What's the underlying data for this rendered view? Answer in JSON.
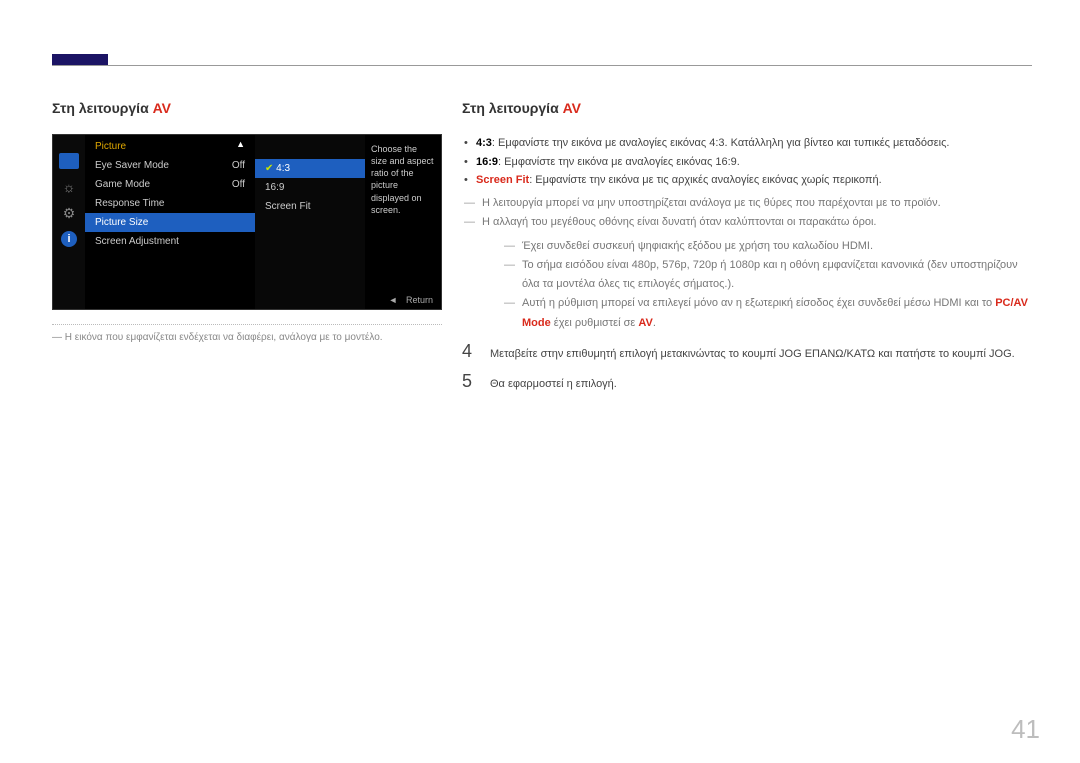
{
  "page_number": "41",
  "left": {
    "heading_prefix": "Στη λειτουργία ",
    "heading_av": "AV",
    "osd": {
      "title": "Picture",
      "items": [
        {
          "label": "Eye Saver Mode",
          "value": "Off"
        },
        {
          "label": "Game Mode",
          "value": "Off"
        },
        {
          "label": "Response Time",
          "value": ""
        },
        {
          "label": "Picture Size",
          "value": ""
        },
        {
          "label": "Screen Adjustment",
          "value": ""
        }
      ],
      "sub_options": [
        "4:3",
        "16:9",
        "Screen Fit"
      ],
      "description": "Choose the size and aspect ratio of the picture displayed on screen.",
      "return_label": "Return",
      "info_glyph": "i"
    },
    "caption_dash": "―",
    "caption": "Η εικόνα που εμφανίζεται ενδέχεται να διαφέρει, ανάλογα με το μοντέλο."
  },
  "right": {
    "heading_prefix": "Στη λειτουργία ",
    "heading_av": "AV",
    "bullet1_label": "4:3",
    "bullet1_text": ": Εμφανίστε την εικόνα με αναλογίες εικόνας 4:3. Κατάλληλη για βίντεο και τυπικές μεταδόσεις.",
    "bullet2_label": "16:9",
    "bullet2_text": ": Εμφανίστε την εικόνα με αναλογίες εικόνας 16:9.",
    "bullet3_label": "Screen Fit",
    "bullet3_text": ": Εμφανίστε την εικόνα με τις αρχικές αναλογίες εικόνας χωρίς περικοπή.",
    "dash1": "Η λειτουργία μπορεί να μην υποστηρίζεται ανάλογα με τις θύρες που παρέχονται με το προϊόν.",
    "dash2": "Η αλλαγή του μεγέθους οθόνης είναι δυνατή όταν καλύπτονται οι παρακάτω όροι.",
    "sub1": "Έχει συνδεθεί συσκευή ψηφιακής εξόδου με χρήση του καλωδίου HDMI.",
    "sub2": "Το σήμα εισόδου είναι 480p, 576p, 720p ή 1080p και η οθόνη εμφανίζεται κανονικά (δεν υποστηρίζουν όλα τα μοντέλα όλες τις επιλογές σήματος.).",
    "sub3_a": "Αυτή η ρύθμιση μπορεί να επιλεγεί μόνο αν η εξωτερική είσοδος έχει συνδεθεί μέσω HDMI και το ",
    "sub3_pcav": "PC/AV Mode",
    "sub3_b": " έχει ρυθμιστεί σε ",
    "sub3_av": "AV",
    "sub3_c": ".",
    "step4": "Μεταβείτε στην επιθυμητή επιλογή μετακινώντας το κουμπί JOG ΕΠΑΝΩ/ΚΑΤΩ και πατήστε το κουμπί JOG.",
    "step5": "Θα εφαρμοστεί η επιλογή.",
    "num4": "4",
    "num5": "5"
  }
}
